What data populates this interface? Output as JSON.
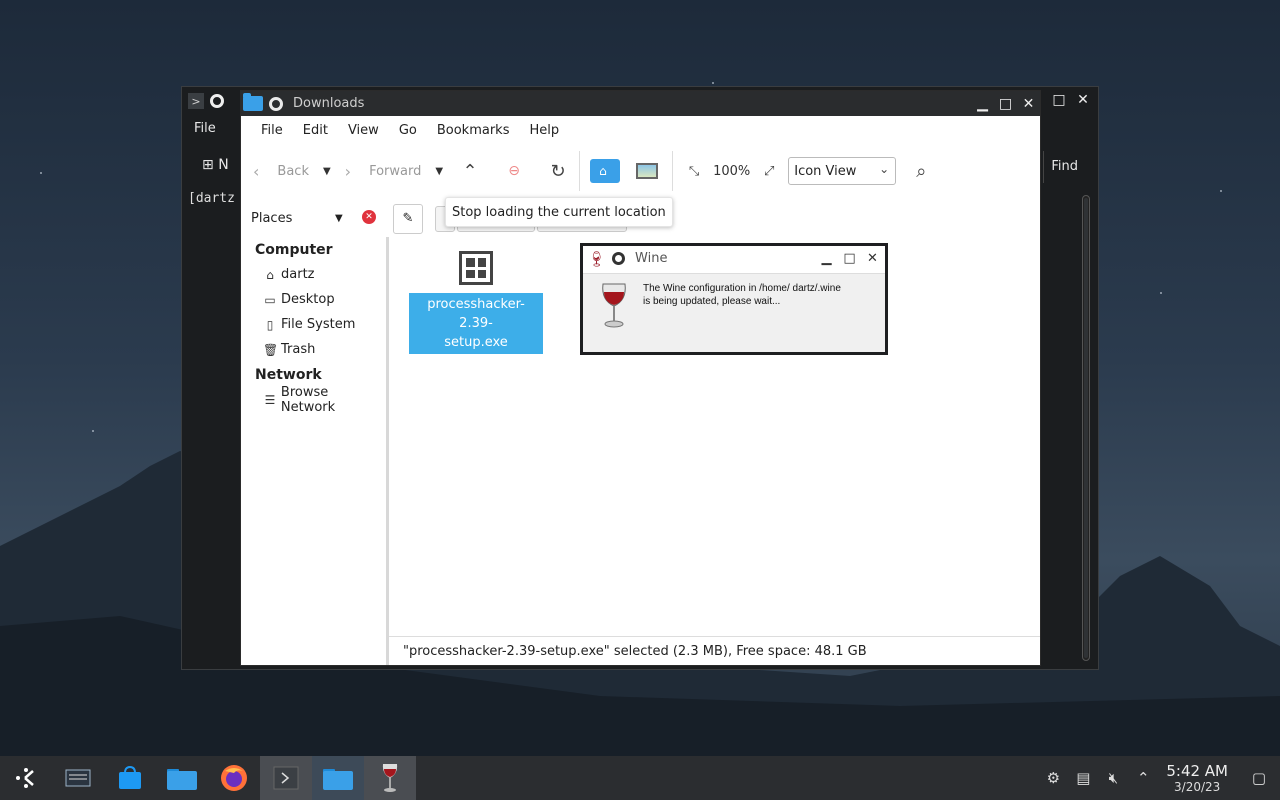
{
  "terminal": {
    "menu_file": "File",
    "toolbar_new": "N",
    "toolbar_find": "Find",
    "prompt": "[dartz"
  },
  "file_manager": {
    "title": "Downloads",
    "menu": [
      "File",
      "Edit",
      "View",
      "Go",
      "Bookmarks",
      "Help"
    ],
    "toolbar": {
      "back": "Back",
      "forward": "Forward",
      "zoom": "100%",
      "view_mode": "Icon View"
    },
    "tooltip": "Stop loading the current location",
    "places_label": "Places",
    "sidebar": {
      "computer_label": "Computer",
      "computer_items": [
        {
          "label": "dartz",
          "icon": "home-icon"
        },
        {
          "label": "Desktop",
          "icon": "desktop-icon"
        },
        {
          "label": "File System",
          "icon": "drive-icon"
        },
        {
          "label": "Trash",
          "icon": "trash-icon"
        }
      ],
      "network_label": "Network",
      "network_items": [
        {
          "label": "Browse Network",
          "icon": "network-icon"
        }
      ]
    },
    "files": [
      {
        "name": "processhacker-2.39-setup.exe",
        "label_line1": "processhacker-2.39-",
        "label_line2": "setup.exe",
        "selected": true
      }
    ],
    "status": "\"processhacker-2.39-setup.exe\" selected (2.3 MB), Free space: 48.1 GB"
  },
  "wine_dialog": {
    "title": "Wine",
    "message": "The Wine configuration in /home/ dartz/.wine is being updated, please wait..."
  },
  "taskbar": {
    "apps": [
      "launcher-icon",
      "task-manager-icon",
      "discover-store-icon",
      "dolphin-folder-icon",
      "firefox-icon",
      "konsole-icon",
      "pcmanfm-folder-icon",
      "wine-icon"
    ],
    "time": "5:42 AM",
    "date": "3/20/23"
  },
  "colors": {
    "selection": "#3daee9",
    "titlebar_dark": "#2a2c2e",
    "folder_blue": "#3aa0e8",
    "taskbar": "#2b2d30"
  }
}
